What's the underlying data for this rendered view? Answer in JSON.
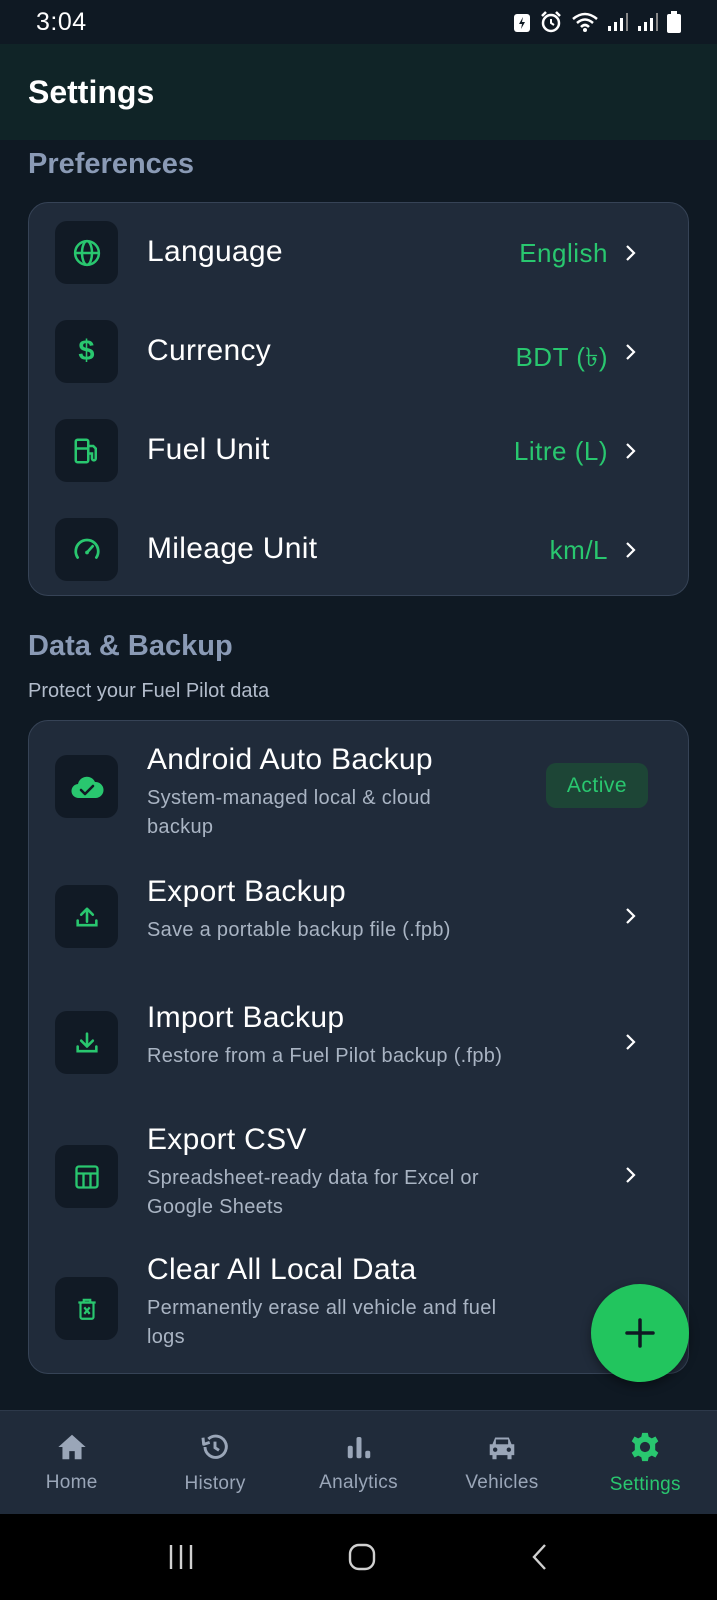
{
  "status_bar": {
    "time": "3:04"
  },
  "app_bar": {
    "title": "Settings"
  },
  "preferences": {
    "title": "Preferences",
    "items": [
      {
        "label": "Language",
        "value": "English",
        "icon": "globe-icon"
      },
      {
        "label": "Currency",
        "value": "BDT (৳)",
        "icon": "dollar-icon"
      },
      {
        "label": "Fuel Unit",
        "value": "Litre (L)",
        "icon": "fuel-pump-icon"
      },
      {
        "label": "Mileage Unit",
        "value": "km/L",
        "icon": "speedometer-icon"
      }
    ]
  },
  "data_backup": {
    "title": "Data & Backup",
    "subtitle": "Protect your Fuel Pilot data",
    "items": [
      {
        "title": "Android Auto Backup",
        "desc1": "System-managed local & cloud",
        "desc2": "backup",
        "badge": "Active",
        "icon": "cloud-check-icon"
      },
      {
        "title": "Export Backup",
        "desc1": "Save a portable backup file (.fpb)",
        "icon": "upload-icon"
      },
      {
        "title": "Import Backup",
        "desc1": "Restore from a Fuel Pilot backup (.fpb)",
        "icon": "download-icon"
      },
      {
        "title": "Export CSV",
        "desc1": "Spreadsheet-ready data for Excel or",
        "desc2": "Google Sheets",
        "icon": "table-icon"
      },
      {
        "title": "Clear All Local Data",
        "desc1": "Permanently erase all vehicle and fuel",
        "desc2": "logs",
        "icon": "delete-icon"
      }
    ]
  },
  "bottom_nav": {
    "items": [
      {
        "label": "Home",
        "icon": "home-icon"
      },
      {
        "label": "History",
        "icon": "history-icon"
      },
      {
        "label": "Analytics",
        "icon": "analytics-icon"
      },
      {
        "label": "Vehicles",
        "icon": "car-icon"
      },
      {
        "label": "Settings",
        "icon": "gear-icon",
        "active": true
      }
    ]
  },
  "colors": {
    "accent": "#29c76f",
    "background": "#0f1923",
    "card": "#202b3a",
    "fab": "#22c55e"
  }
}
